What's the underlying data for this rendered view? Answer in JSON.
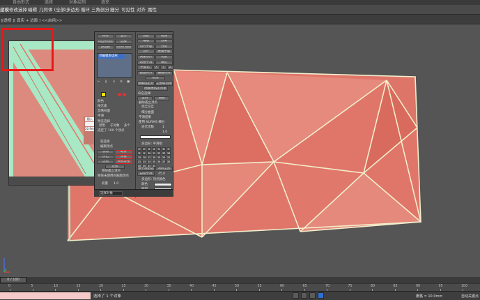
{
  "top_tabs": [
    "自由形式",
    "选择",
    "对象绘制",
    "填充"
  ],
  "ribbon": {
    "items": [
      "建模",
      "修改选择",
      "编辑",
      "几何体 (全部)",
      "多边形",
      "循环",
      "三角剖分",
      "细分",
      "可见性",
      "对齐",
      "属性"
    ],
    "active_index": 0
  },
  "viewport_label": "][透视 ][ 真实 + 边面 ] <<启用>>",
  "colors": {
    "mesh_fill": "#e0766a",
    "mesh_edge": "#f2eecc",
    "highlight_edge": "#a8e8c4",
    "annotation": "#e81818",
    "viewport_bg": "#555555"
  },
  "reference_image": {
    "mini_buttons": [
      "插入",
      "",
      "20.9mm"
    ]
  },
  "panel": {
    "left": {
      "tabs": [
        "修改",
        "显示"
      ],
      "row2": [
        "四边形绘图",
        "选择"
      ],
      "row3": [
        "多边形",
        "1000 顶点"
      ],
      "list_selected": "可编辑多边形",
      "icons_row": [
        "pin-icon",
        "stack-icon",
        "unique-icon",
        "remove-icon",
        "config-icon"
      ],
      "lbls": [
        "颜色",
        "材质ID",
        "按元素",
        "忽略背面",
        "平滑",
        "预览选择",
        "禁用",
        "子对象",
        "多个",
        "选定了 100 个顶点"
      ],
      "soft_title": "软选择",
      "section_title": "编辑顶点",
      "btn_remove": "移除",
      "btn_break": "断开",
      "btn_extrude": "挤出",
      "btn_weld": "焊接",
      "btn_chamfer": "切角",
      "btn_target_weld": "目标焊接",
      "btn_connect": "连接",
      "lbl_remove_iso": "移除孤立顶点",
      "lbl_remove_unused": "移除未使用的贴图顶点",
      "lbl_weight": "权重",
      "weight_value": "1.0"
    },
    "right": {
      "tabs": [
        "创建",
        "附加"
      ],
      "r1": [
        "塌陷",
        "分离"
      ],
      "r2": [
        "切片平面",
        "分割"
      ],
      "r3": [
        "切片",
        "重置平面"
      ],
      "r4": [
        "快速切片",
        "切割"
      ],
      "r5": [
        "网格平滑",
        "细化"
      ],
      "r6": [
        "平面化",
        "X",
        "Y",
        "Z"
      ],
      "r7": [
        "视图对齐",
        "栅格对齐"
      ],
      "r8": [
        "松弛"
      ],
      "r9": [
        "隐藏选定对象",
        "全部取消隐藏"
      ],
      "r10": [
        "隐藏未选定对象"
      ],
      "named_sel": "命名选择:",
      "copy_paste": [
        "复制",
        "粘贴"
      ],
      "delete_iso": "删除孤立顶点",
      "full_interact": "完全交互",
      "subdiv_title": "细分曲面",
      "smooth_label": "平滑结果",
      "use_nurms": "使用 NURMS 细分",
      "iter_label": "迭代次数",
      "iter_value": "1",
      "smooth_value": "1.0",
      "show_cage": "显示框架",
      "display_label": "显示",
      "render_label": "渲染",
      "grid_title": "多边形: 平滑组",
      "grid_numbers": [
        "1",
        "2",
        "3",
        "4",
        "5",
        "6",
        "7",
        "8",
        "9",
        "10",
        "11",
        "12",
        "13",
        "14",
        "15",
        "16",
        "17",
        "18",
        "19",
        "20",
        "21",
        "22",
        "23",
        "24",
        "25",
        "26",
        "27",
        "28",
        "29",
        "30",
        "31",
        "32"
      ],
      "select_by_sg": "按平滑组选择",
      "clear_all": "清除全部",
      "auto_smooth": "自动平滑",
      "auto_value": "45.0",
      "vertex_color_title": "多边形: 顶点颜色",
      "vc_color": "颜色",
      "vc_illum": "照明"
    },
    "bottom_select": "选择对象"
  },
  "timeline": {
    "slider_text": "0 / 100",
    "ticks": [
      "0",
      "5",
      "10",
      "15",
      "20",
      "25",
      "30",
      "35",
      "40",
      "45",
      "50",
      "55",
      "60",
      "65",
      "70",
      "75",
      "80",
      "85",
      "90",
      "95",
      "100"
    ]
  },
  "status": {
    "text": "选择了 1 个对象",
    "grid": "栅格 = 10.0mm",
    "auto": "自动关键点"
  }
}
